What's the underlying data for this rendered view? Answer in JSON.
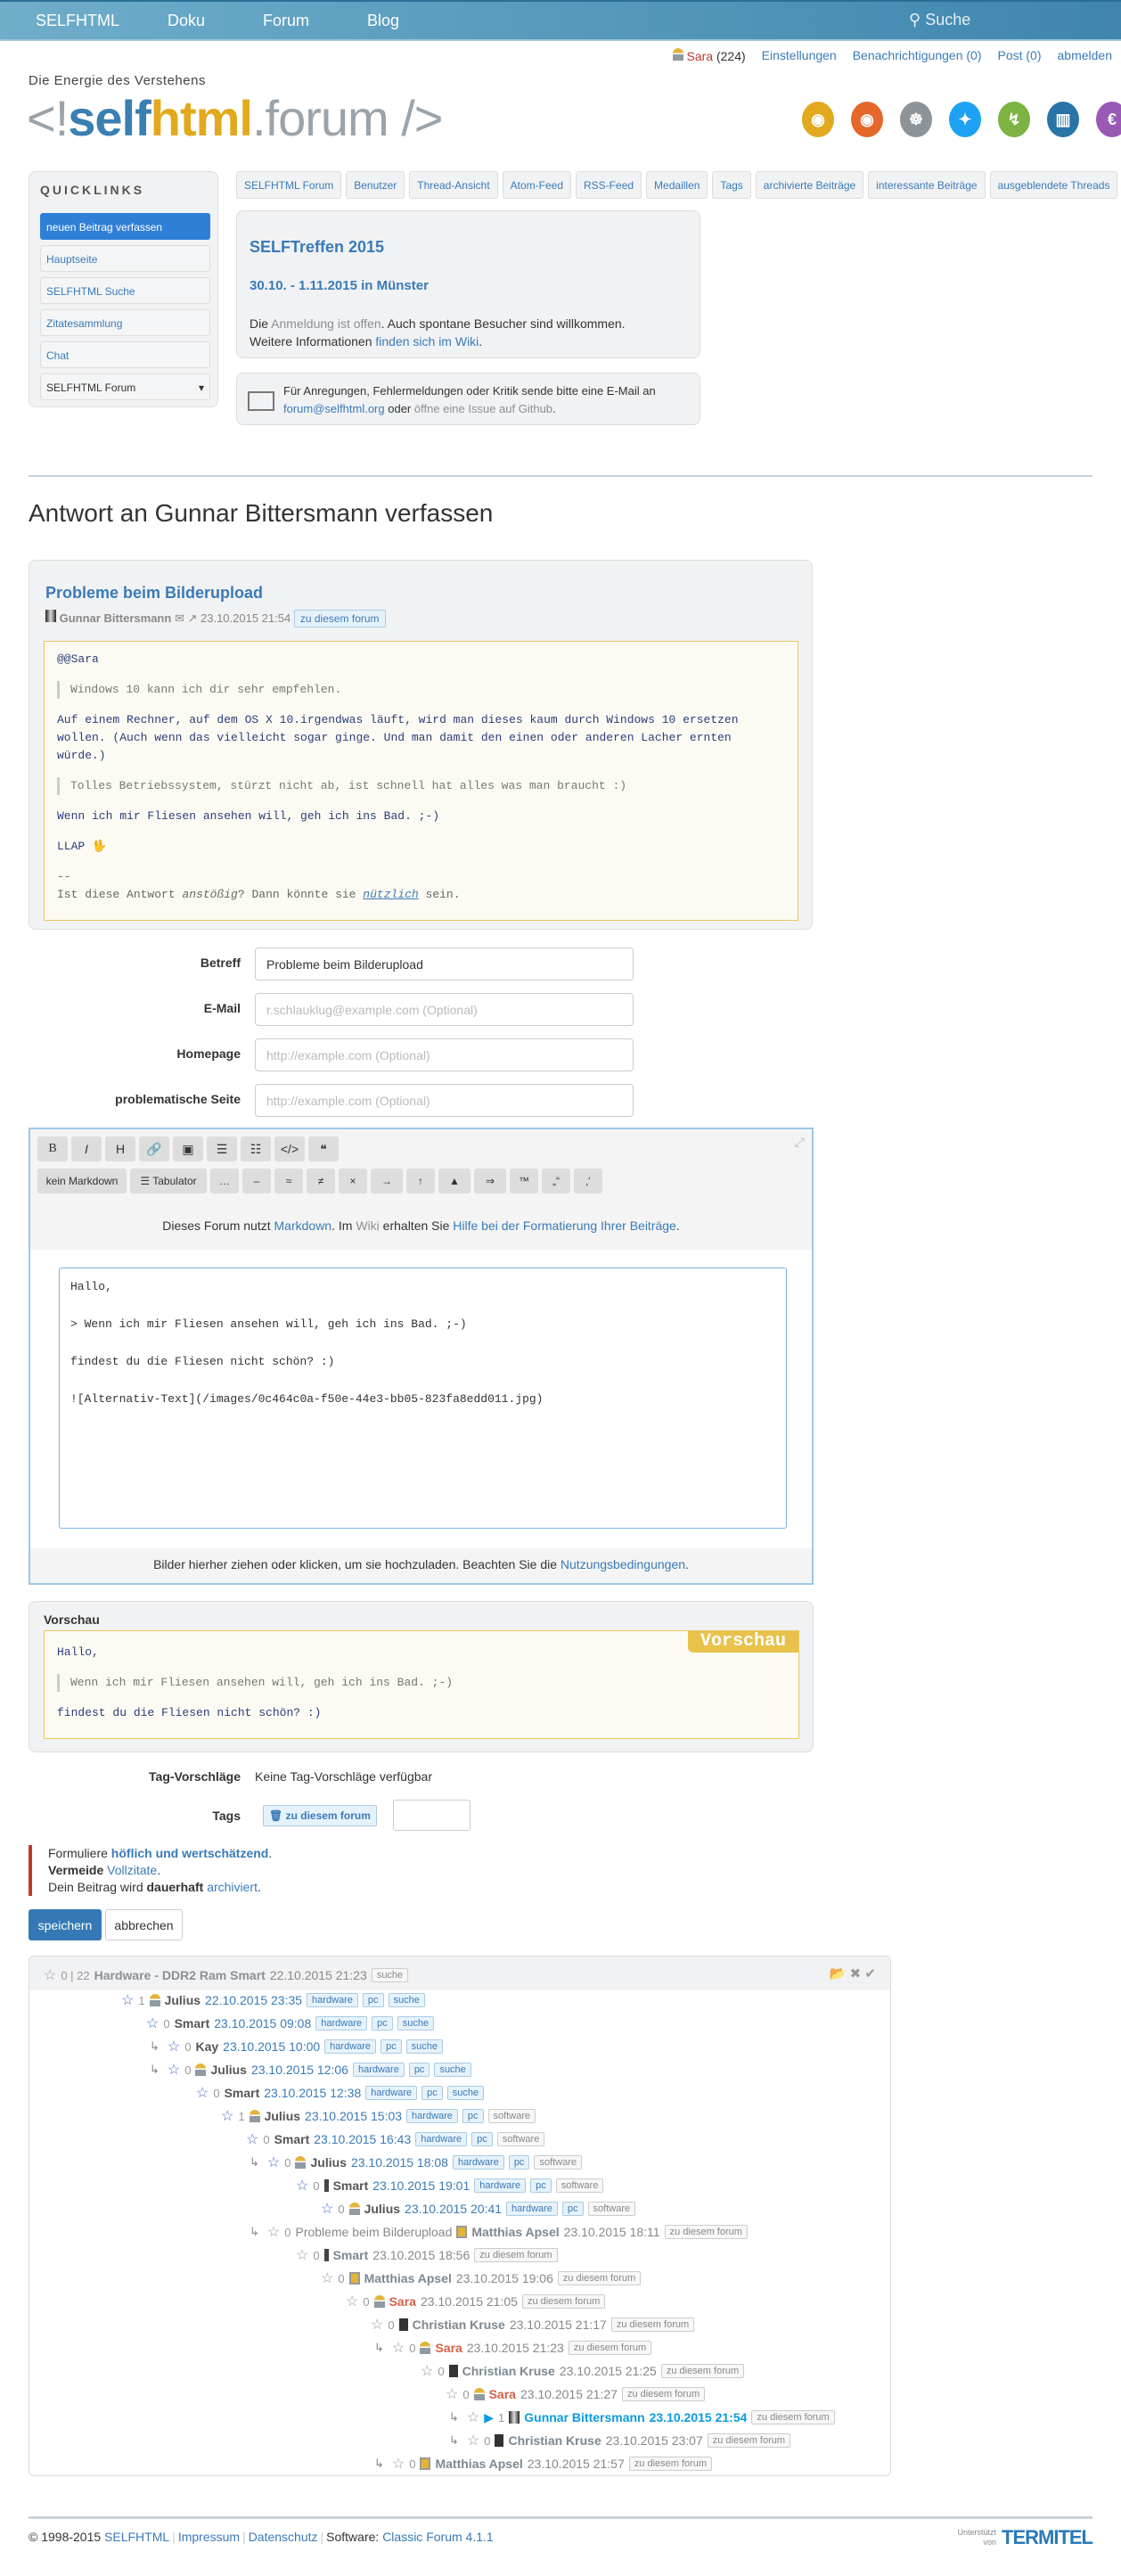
{
  "topnav": {
    "items": [
      "SELFHTML",
      "Doku",
      "Forum",
      "Blog"
    ],
    "search_placeholder": "Suche"
  },
  "userbar": {
    "user": "Sara",
    "points": "(224)",
    "settings": "Einstellungen",
    "notifications": "Benachrichtigungen (0)",
    "post": "Post (0)",
    "logout": "abmelden"
  },
  "brand": {
    "tagline": "Die Energie des Verstehens",
    "logo": "<!selfhtml.forum />"
  },
  "social": [
    {
      "icon": "rss-icon",
      "color": "#e2a91e"
    },
    {
      "icon": "rss-icon",
      "color": "#e5672a"
    },
    {
      "icon": "github-icon",
      "color": "#8d9499"
    },
    {
      "icon": "twitter-icon",
      "color": "#1da1f2"
    },
    {
      "icon": "flattr-icon",
      "color": "#7cb342"
    },
    {
      "icon": "trello-icon",
      "color": "#2a73a8"
    },
    {
      "icon": "euro-icon",
      "color": "#9b59b6"
    }
  ],
  "quicklinks": {
    "title": "QUICKLINKS",
    "items": [
      "neuen Beitrag verfassen",
      "Hauptseite",
      "SELFHTML Suche",
      "Zitatesammlung",
      "Chat"
    ],
    "select": "SELFHTML Forum"
  },
  "nav": [
    "SELFHTML Forum",
    "Benutzer",
    "Thread-Ansicht",
    "Atom-Feed",
    "RSS-Feed",
    "Medaillen",
    "Tags",
    "archivierte Beiträge",
    "interessante Beiträge",
    "ausgeblendete Threads"
  ],
  "treffen": {
    "title": "SELFTreffen 2015",
    "date": "30.10. - 1.11.2015 in Münster",
    "t1": "Die ",
    "l1": "Anmeldung ist offen",
    "t2": ". Auch spontane Besucher sind willkommen.",
    "t3": "Weitere Informationen ",
    "l2": "finden sich im Wiki",
    "t4": "."
  },
  "mail": {
    "t1": "Für Anregungen, Fehlermeldungen oder Kritik sende bitte eine E-Mail an ",
    "l1": "forum@selfhtml.org",
    "t2": " oder ",
    "l2": "öffne eine Issue auf Github",
    "t3": "."
  },
  "heading": "Antwort an Gunnar Bittersmann verfassen",
  "post": {
    "title": "Probleme beim Bilderupload",
    "author": "Gunnar Bittersmann",
    "date": "23.10.2015 21:54",
    "tag": "zu diesem forum",
    "lines": [
      "@@Sara",
      "Windows 10 kann ich dir sehr empfehlen.",
      "Auf einem Rechner, auf dem OS X 10.irgendwas läuft, wird man dieses kaum durch Windows 10 ersetzen wollen. (Auch wenn das vielleicht sogar ginge. Und man damit den einen oder anderen Lacher ernten würde.)",
      "Tolles Betriebssystem, stürzt nicht ab, ist schnell hat alles was man braucht :)",
      "Wenn ich mir Fliesen ansehen will, geh ich ins Bad. ;-)",
      "LLAP 🖖"
    ],
    "sig1": "--",
    "sig2": "Ist diese Antwort ",
    "sig_em": "anstößig",
    "sig3": "? Dann könnte sie ",
    "sig_link": "nützlich",
    "sig4": " sein."
  },
  "form": {
    "subject_label": "Betreff",
    "subject_value": "Probleme beim Bilderupload",
    "email_label": "E-Mail",
    "email_placeholder": "r.schlauklug@example.com (Optional)",
    "homepage_label": "Homepage",
    "homepage_placeholder": "http://example.com (Optional)",
    "problem_label": "problematische Seite",
    "problem_placeholder": "http://example.com (Optional)"
  },
  "editor": {
    "row1": [
      "B",
      "I",
      "H",
      "🔗",
      "▣",
      "☰",
      "☷",
      "</>",
      "❝"
    ],
    "row2": [
      "kein Markdown",
      "☰ Tabulator",
      "…",
      "–",
      "≈",
      "≠",
      "×",
      "→",
      "↑",
      "▲",
      "⇒",
      "™",
      "„“",
      "‚‘"
    ],
    "info1": "Dieses Forum nutzt ",
    "info_l1": "Markdown",
    "info2": ". Im ",
    "info_l2": "Wiki",
    "info3": " erhalten Sie ",
    "info_l3": "Hilfe bei der Formatierung Ihrer Beiträge",
    "info4": ".",
    "text": "Hallo,\n\n> Wenn ich mir Fliesen ansehen will, geh ich ins Bad. ;-)\n\nfindest du die Fliesen nicht schön? :)\n\n![Alternativ-Text](/images/0c464c0a-f50e-44e3-bb05-823fa8edd011.jpg)",
    "upload1": "Bilder hierher ziehen oder klicken, um sie hochzuladen. Beachten Sie die ",
    "upload_l": "Nutzungsbedingungen",
    "upload2": "."
  },
  "preview": {
    "label": "Vorschau",
    "badge": "Vorschau",
    "l1": "Hallo,",
    "q": "Wenn ich mir Fliesen ansehen will, geh ich ins Bad. ;-)",
    "l2": "findest du die Fliesen nicht schön? :)"
  },
  "tags": {
    "suggest_label": "Tag-Vorschläge",
    "suggest_value": "Keine Tag-Vorschläge verfügbar",
    "label": "Tags",
    "tag": "zu diesem forum"
  },
  "notice": {
    "a1": "Formuliere ",
    "a2": "höflich und wertschätzend",
    "a3": ".",
    "b1": "Vermeide",
    "b2": " ",
    "b3": "Vollzitate",
    "b4": ".",
    "c1": "Dein Beitrag wird ",
    "c2": "dauerhaft",
    "c3": " ",
    "c4": "archiviert",
    "c5": "."
  },
  "buttons": {
    "save": "speichern",
    "cancel": "abbrechen"
  },
  "thread": {
    "root": {
      "score": "0 | 22",
      "title": "Hardware - DDR2 Ram Smart",
      "date": "22.10.2015 21:23",
      "tags": [
        "suche"
      ]
    },
    "rows": [
      {
        "depth": 1,
        "score": "1",
        "icon": "user",
        "author": "Julius",
        "date": "22.10.2015 23:35",
        "tags": [
          "hardware",
          "pc",
          "suche"
        ],
        "arrow": false,
        "style": "blue"
      },
      {
        "depth": 2,
        "score": "0",
        "icon": "",
        "author": "Smart",
        "date": "23.10.2015 09:08",
        "tags": [
          "hardware",
          "pc",
          "suche"
        ],
        "arrow": false,
        "style": "blue"
      },
      {
        "depth": 3,
        "score": "0",
        "icon": "",
        "author": "Kay",
        "date": "23.10.2015 10:00",
        "tags": [
          "hardware",
          "pc",
          "suche"
        ],
        "arrow": true,
        "style": "blue"
      },
      {
        "depth": 3,
        "score": "0",
        "icon": "user",
        "author": "Julius",
        "date": "23.10.2015 12:06",
        "tags": [
          "hardware",
          "pc",
          "suche"
        ],
        "arrow": true,
        "style": "blue"
      },
      {
        "depth": 4,
        "score": "0",
        "icon": "",
        "author": "Smart",
        "date": "23.10.2015 12:38",
        "tags": [
          "hardware",
          "pc",
          "suche"
        ],
        "arrow": false,
        "style": "blue"
      },
      {
        "depth": 5,
        "score": "1",
        "icon": "user",
        "author": "Julius",
        "date": "23.10.2015 15:03",
        "tags": [
          "hardware",
          "pc",
          "software"
        ],
        "arrow": false,
        "style": "blue"
      },
      {
        "depth": 6,
        "score": "0",
        "icon": "",
        "author": "Smart",
        "date": "23.10.2015 16:43",
        "tags": [
          "hardware",
          "pc",
          "software"
        ],
        "arrow": false,
        "style": "blue"
      },
      {
        "depth": 7,
        "score": "0",
        "icon": "user",
        "author": "Julius",
        "date": "23.10.2015 18:08",
        "tags": [
          "hardware",
          "pc",
          "software"
        ],
        "arrow": true,
        "style": "blue"
      },
      {
        "depth": 8,
        "score": "0",
        "icon": "ex",
        "author": "Smart",
        "date": "23.10.2015 19:01",
        "tags": [
          "hardware",
          "pc",
          "software"
        ],
        "arrow": false,
        "style": "blue"
      },
      {
        "depth": 9,
        "score": "0",
        "icon": "user",
        "author": "Julius",
        "date": "23.10.2015 20:41",
        "tags": [
          "hardware",
          "pc",
          "software"
        ],
        "arrow": false,
        "style": "blue"
      },
      {
        "depth": 7,
        "score": "0",
        "title": "Probleme beim Bilderupload",
        "icon": "ma",
        "author": "Matthias Apsel",
        "date": "23.10.2015 18:11",
        "tags": [
          "zu diesem forum"
        ],
        "arrow": true,
        "style": "grey"
      },
      {
        "depth": 8,
        "score": "0",
        "icon": "ex",
        "author": "Smart",
        "date": "23.10.2015 18:56",
        "tags": [
          "zu diesem forum"
        ],
        "arrow": false,
        "style": "grey"
      },
      {
        "depth": 9,
        "score": "0",
        "icon": "ma",
        "author": "Matthias Apsel",
        "date": "23.10.2015 19:06",
        "tags": [
          "zu diesem forum"
        ],
        "arrow": false,
        "style": "grey"
      },
      {
        "depth": 10,
        "score": "0",
        "icon": "user",
        "author": "Sara",
        "date": "23.10.2015 21:05",
        "tags": [
          "zu diesem forum"
        ],
        "arrow": false,
        "style": "grey"
      },
      {
        "depth": 11,
        "score": "0",
        "icon": "ck",
        "author": "Christian Kruse",
        "date": "23.10.2015 21:17",
        "tags": [
          "zu diesem forum"
        ],
        "arrow": false,
        "style": "grey"
      },
      {
        "depth": 12,
        "score": "0",
        "icon": "user",
        "author": "Sara",
        "date": "23.10.2015 21:23",
        "tags": [
          "zu diesem forum"
        ],
        "arrow": true,
        "style": "grey"
      },
      {
        "depth": 13,
        "score": "0",
        "icon": "ck",
        "author": "Christian Kruse",
        "date": "23.10.2015 21:25",
        "tags": [
          "zu diesem forum"
        ],
        "arrow": false,
        "style": "grey"
      },
      {
        "depth": 14,
        "score": "0",
        "icon": "user",
        "author": "Sara",
        "date": "23.10.2015 21:27",
        "tags": [
          "zu diesem forum"
        ],
        "arrow": false,
        "style": "grey"
      },
      {
        "depth": 15,
        "score": "1",
        "icon": "gb",
        "author": "Gunnar Bittersmann",
        "date": "23.10.2015 21:54",
        "tags": [
          "zu diesem forum"
        ],
        "arrow": true,
        "style": "current"
      },
      {
        "depth": 15,
        "score": "0",
        "icon": "ck",
        "author": "Christian Kruse",
        "date": "23.10.2015 23:07",
        "tags": [
          "zu diesem forum"
        ],
        "arrow": true,
        "style": "grey"
      },
      {
        "depth": 12,
        "score": "0",
        "icon": "ma",
        "author": "Matthias Apsel",
        "date": "23.10.2015 21:57",
        "tags": [
          "zu diesem forum"
        ],
        "arrow": true,
        "style": "grey"
      }
    ]
  },
  "footer": {
    "copy": "© 1998-2015 ",
    "selfhtml": "SELFHTML",
    "impressum": "Impressum",
    "datenschutz": "Datenschutz",
    "software": "Software: ",
    "software_link": "Classic Forum 4.1.1",
    "sponsor1": "Unterstützt",
    "sponsor2": "von",
    "sponsor_logo": "TERMITEL"
  }
}
